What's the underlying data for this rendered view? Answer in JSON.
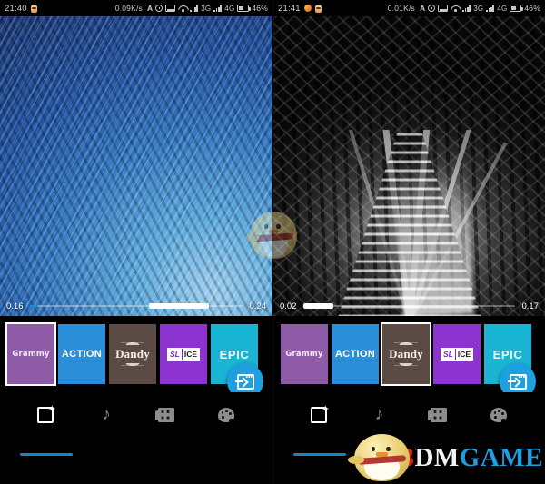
{
  "app": {
    "name": "video-editor",
    "accent": "#1e9fe0"
  },
  "panels": [
    {
      "id": "left",
      "statusbar": {
        "clock": "21:40",
        "left_icons": [
          "chick-badge-icon"
        ],
        "net_rate": "0.09K/s",
        "icons": [
          "letter-a-icon",
          "alarm-icon",
          "sd-card-icon",
          "wifi-icon"
        ],
        "signal_1_label": "3G",
        "signal_2_label": "4G",
        "battery_label": "46%"
      },
      "video": {
        "style": "blue-water-texture",
        "time_current": "0.16",
        "time_total": "0.24",
        "progress_percent": 4,
        "selection_start_percent": 56,
        "selection_width_percent": 28
      },
      "filters": {
        "selected": "Grammy",
        "items": [
          {
            "label": "Grammy",
            "style": "grammy",
            "color": "#8e5ba6",
            "selected": true
          },
          {
            "label": "ACTION",
            "style": "action",
            "color": "#2a8fd8",
            "selected": false
          },
          {
            "label": "Dandy",
            "style": "dandy",
            "color": "#5c4a45",
            "selected": false
          },
          {
            "label": "SLICE",
            "style": "slice",
            "color": "#8d33cf",
            "selected": false,
            "label_a": "SL",
            "label_b": "ICE"
          },
          {
            "label": "EPIC",
            "style": "epic",
            "color": "#1ab4d4",
            "selected": false
          }
        ]
      },
      "fab": {
        "name": "export-button",
        "icon": "export-sheet-icon"
      },
      "bottomnav": {
        "active_index": 0,
        "items": [
          {
            "name": "effects",
            "icon": "effects-sparkle-icon",
            "active": true
          },
          {
            "name": "music",
            "icon": "music-note-icon",
            "active": false
          },
          {
            "name": "clips",
            "icon": "film-strip-icon",
            "active": false
          },
          {
            "name": "palette",
            "icon": "color-palette-icon",
            "active": false
          }
        ]
      }
    },
    {
      "id": "right",
      "statusbar": {
        "clock": "21:41",
        "left_icons": [
          "orange-dot-icon",
          "chick-badge-icon"
        ],
        "net_rate": "0.01K/s",
        "icons": [
          "letter-a-icon",
          "alarm-icon",
          "sd-card-icon",
          "wifi-icon"
        ],
        "signal_1_label": "3G",
        "signal_2_label": "4G",
        "battery_label": "46%"
      },
      "video": {
        "style": "bw-shatter-rails",
        "time_current": "0.02",
        "time_total": "0.17",
        "progress_percent": 2,
        "selection_start_percent": 0,
        "selection_width_percent": 14
      },
      "filters": {
        "selected": "Dandy",
        "items": [
          {
            "label": "Grammy",
            "style": "grammy",
            "color": "#8e5ba6",
            "selected": false
          },
          {
            "label": "ACTION",
            "style": "action",
            "color": "#2a8fd8",
            "selected": false
          },
          {
            "label": "Dandy",
            "style": "dandy",
            "color": "#5c4a45",
            "selected": true
          },
          {
            "label": "SLICE",
            "style": "slice",
            "color": "#8d33cf",
            "selected": false,
            "label_a": "SL",
            "label_b": "ICE"
          },
          {
            "label": "EPIC",
            "style": "epic",
            "color": "#1ab4d4",
            "selected": false
          }
        ]
      },
      "fab": {
        "name": "export-button",
        "icon": "export-sheet-icon"
      },
      "bottomnav": {
        "active_index": 0,
        "items": [
          {
            "name": "effects",
            "icon": "effects-sparkle-icon",
            "active": true
          },
          {
            "name": "music",
            "icon": "music-note-icon",
            "active": false
          },
          {
            "name": "clips",
            "icon": "film-strip-icon",
            "active": false
          },
          {
            "name": "palette",
            "icon": "color-palette-icon",
            "active": false
          }
        ]
      }
    }
  ],
  "watermarks": {
    "center": {
      "name": "chick-mascot-watermark"
    },
    "corner": {
      "name": "3dmgame-watermark",
      "text_part_1": "3",
      "text_part_2": "DM",
      "text_part_3": "GAME"
    }
  }
}
